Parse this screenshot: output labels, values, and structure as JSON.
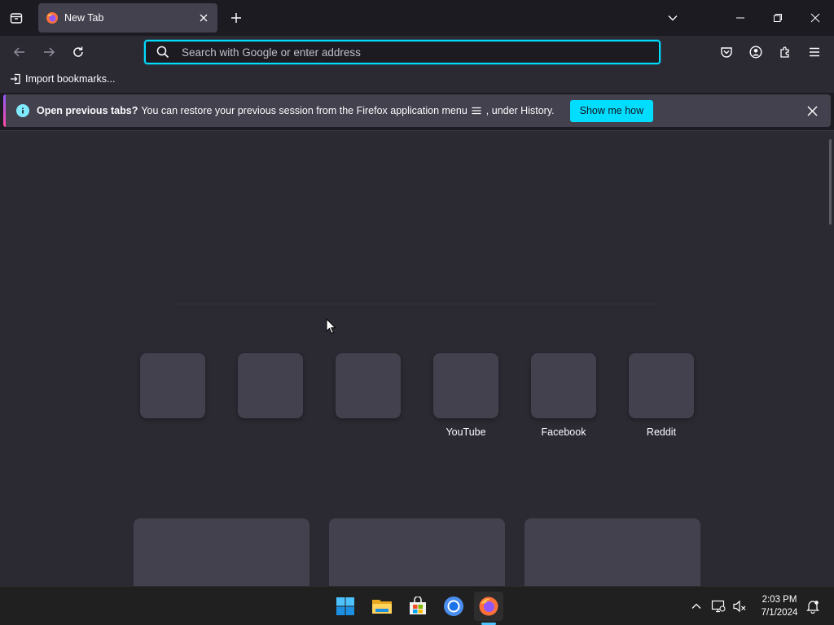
{
  "tabs": [
    {
      "title": "New Tab"
    }
  ],
  "urlbar": {
    "placeholder": "Search with Google or enter address"
  },
  "bookmarks": [
    {
      "label": "Import bookmarks..."
    }
  ],
  "notification": {
    "bold_text": "Open previous tabs?",
    "text_before_icon": "You can restore your previous session from the Firefox application menu",
    "text_after_icon": ", under History.",
    "button_label": "Show me how"
  },
  "top_sites": [
    {
      "label": ""
    },
    {
      "label": ""
    },
    {
      "label": ""
    },
    {
      "label": "YouTube"
    },
    {
      "label": "Facebook"
    },
    {
      "label": "Reddit"
    }
  ],
  "taskbar": {
    "apps": [
      "start-icon",
      "file-explorer-icon",
      "microsoft-store-icon",
      "chrome-icon",
      "firefox-icon"
    ],
    "time": "2:03 PM",
    "date": "7/1/2024"
  },
  "colors": {
    "accent": "#00ddff",
    "chrome_bg": "#1c1b22",
    "toolbar_bg": "#2b2a33",
    "tile_bg": "#42414d",
    "taskbar_bg": "#202020"
  }
}
